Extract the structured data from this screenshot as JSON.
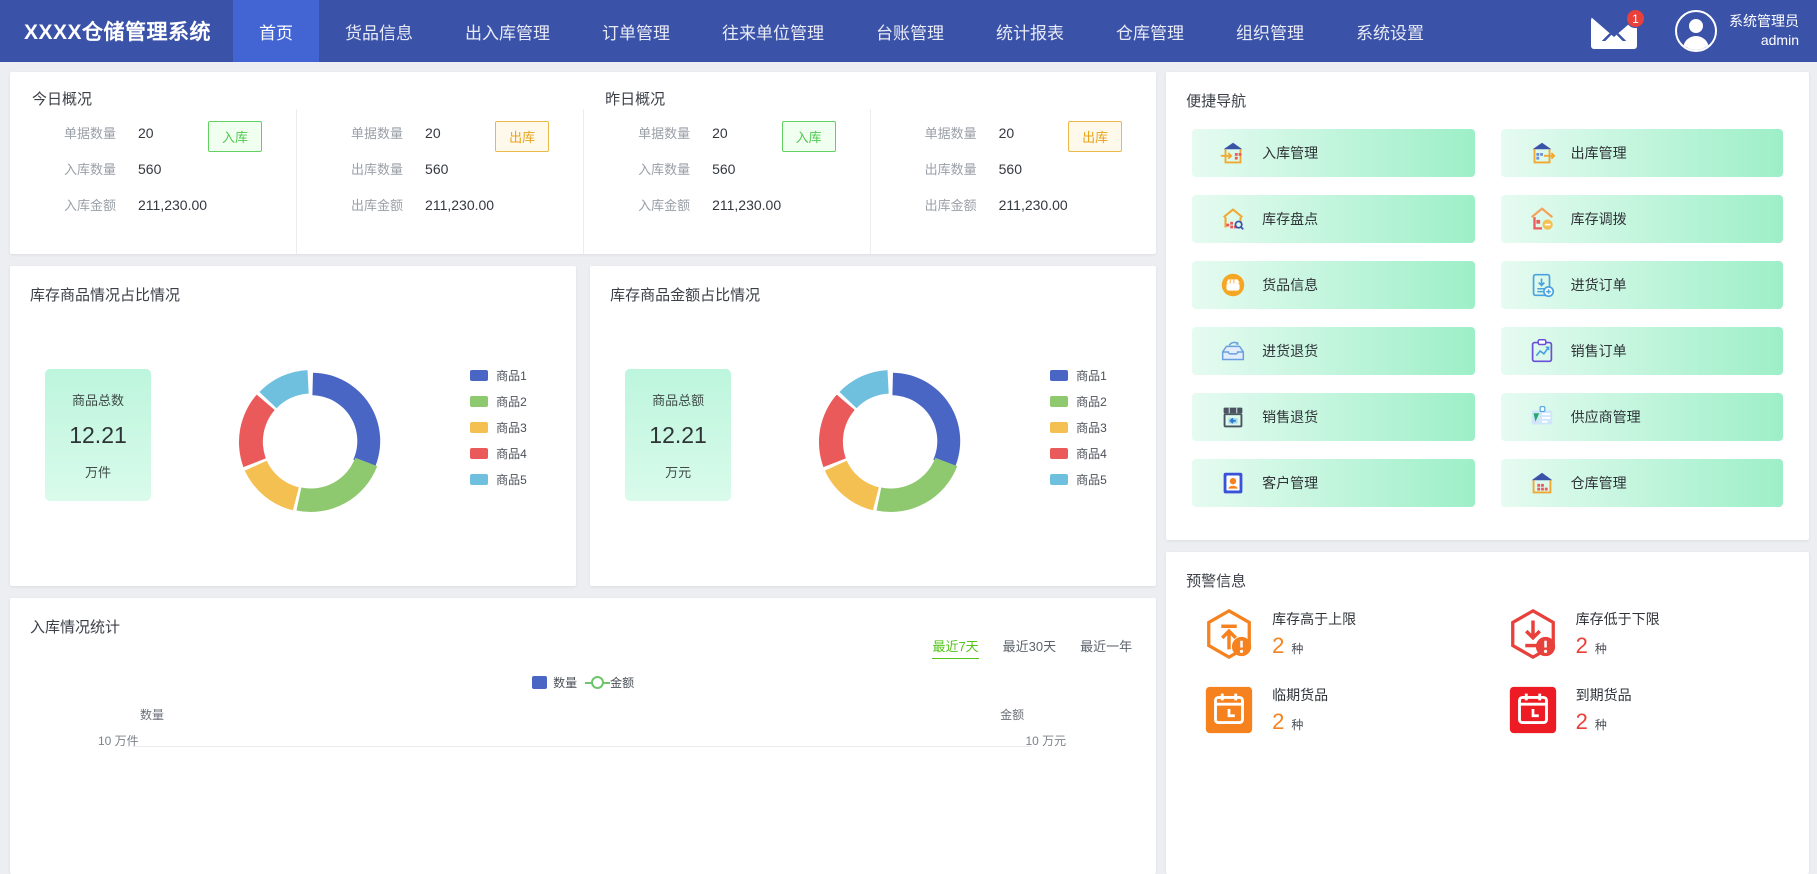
{
  "header": {
    "brand": "XXXX仓储管理系统",
    "nav": [
      {
        "label": "首页",
        "active": true
      },
      {
        "label": "货品信息",
        "active": false
      },
      {
        "label": "出入库管理",
        "active": false
      },
      {
        "label": "订单管理",
        "active": false
      },
      {
        "label": "往来单位管理",
        "active": false
      },
      {
        "label": "台账管理",
        "active": false
      },
      {
        "label": "统计报表",
        "active": false
      },
      {
        "label": "仓库管理",
        "active": false
      },
      {
        "label": "组织管理",
        "active": false
      },
      {
        "label": "系统设置",
        "active": false
      }
    ],
    "mail_badge": "1",
    "user_role": "系统管理员",
    "user_name": "admin",
    "brand_color": "#3a52a8",
    "active_color": "#4365d4"
  },
  "overview": {
    "today": {
      "title": "今日概况",
      "inbound": {
        "tag": "入库",
        "rows": [
          {
            "label": "单据数量",
            "value": "20"
          },
          {
            "label": "入库数量",
            "value": "560"
          },
          {
            "label": "入库金额",
            "value": "211,230.00"
          }
        ]
      },
      "outbound": {
        "tag": "出库",
        "rows": [
          {
            "label": "单据数量",
            "value": "20"
          },
          {
            "label": "出库数量",
            "value": "560"
          },
          {
            "label": "出库金额",
            "value": "211,230.00"
          }
        ]
      }
    },
    "yesterday": {
      "title": "昨日概况",
      "inbound": {
        "tag": "入库",
        "rows": [
          {
            "label": "单据数量",
            "value": "20"
          },
          {
            "label": "入库数量",
            "value": "560"
          },
          {
            "label": "入库金额",
            "value": "211,230.00"
          }
        ]
      },
      "outbound": {
        "tag": "出库",
        "rows": [
          {
            "label": "单据数量",
            "value": "20"
          },
          {
            "label": "出库数量",
            "value": "560"
          },
          {
            "label": "出库金额",
            "value": "211,230.00"
          }
        ]
      }
    }
  },
  "chart_data": [
    {
      "type": "pie",
      "title": "库存商品情况占比情况",
      "center_label": "商品总数",
      "center_value": "12.21",
      "center_unit": "万件",
      "categories": [
        "商品1",
        "商品2",
        "商品3",
        "商品4",
        "商品5"
      ],
      "values": [
        20,
        25,
        18,
        22,
        15
      ],
      "colors": [
        "#4a66c4",
        "#8fc96f",
        "#f5c052",
        "#ea5a5a",
        "#6fc0de"
      ],
      "legend_position": "right",
      "grid": false
    },
    {
      "type": "pie",
      "title": "库存商品金额占比情况",
      "center_label": "商品总额",
      "center_value": "12.21",
      "center_unit": "万元",
      "categories": [
        "商品1",
        "商品2",
        "商品3",
        "商品4",
        "商品5"
      ],
      "values": [
        20,
        25,
        18,
        22,
        15
      ],
      "colors": [
        "#4a66c4",
        "#8fc96f",
        "#f5c052",
        "#ea5a5a",
        "#6fc0de"
      ],
      "legend_position": "right",
      "grid": false
    },
    {
      "type": "bar",
      "title": "入库情况统计",
      "series": [
        {
          "name": "数量",
          "type": "bar",
          "color": "#4a66c4",
          "values": []
        },
        {
          "name": "金额",
          "type": "line",
          "color": "#6ec56e",
          "values": []
        }
      ],
      "categories": [],
      "ylabel_left": "数量",
      "ylabel_right": "金额",
      "ytick_left": "10 万件",
      "ytick_right": "10 万元",
      "ranges": [
        {
          "label": "最近7天",
          "active": true
        },
        {
          "label": "最近30天",
          "active": false
        },
        {
          "label": "最近一年",
          "active": false
        }
      ],
      "grid": true
    }
  ],
  "quicknav": {
    "title": "便捷导航",
    "items": [
      {
        "label": "入库管理",
        "icon": "warehouse-in-icon"
      },
      {
        "label": "出库管理",
        "icon": "warehouse-out-icon"
      },
      {
        "label": "库存盘点",
        "icon": "stock-check-icon"
      },
      {
        "label": "库存调拨",
        "icon": "stock-transfer-icon"
      },
      {
        "label": "货品信息",
        "icon": "goods-info-icon"
      },
      {
        "label": "进货订单",
        "icon": "purchase-order-icon"
      },
      {
        "label": "进货退货",
        "icon": "purchase-return-icon"
      },
      {
        "label": "销售订单",
        "icon": "sales-order-icon"
      },
      {
        "label": "销售退货",
        "icon": "sales-return-icon"
      },
      {
        "label": "供应商管理",
        "icon": "supplier-icon"
      },
      {
        "label": "客户管理",
        "icon": "customer-icon"
      },
      {
        "label": "仓库管理",
        "icon": "warehouse-icon"
      }
    ]
  },
  "warnings": {
    "title": "预警信息",
    "items": [
      {
        "label": "库存高于上限",
        "count": "2",
        "unit": "种",
        "color": "#f5821f",
        "icon": "stock-over-icon"
      },
      {
        "label": "库存低于下限",
        "count": "2",
        "unit": "种",
        "color": "#e8403a",
        "icon": "stock-under-icon"
      },
      {
        "label": "临期货品",
        "count": "2",
        "unit": "种",
        "color": "#f5821f",
        "icon": "near-expiry-icon"
      },
      {
        "label": "到期货品",
        "count": "2",
        "unit": "种",
        "color": "#e8403a",
        "icon": "expired-icon"
      }
    ]
  }
}
